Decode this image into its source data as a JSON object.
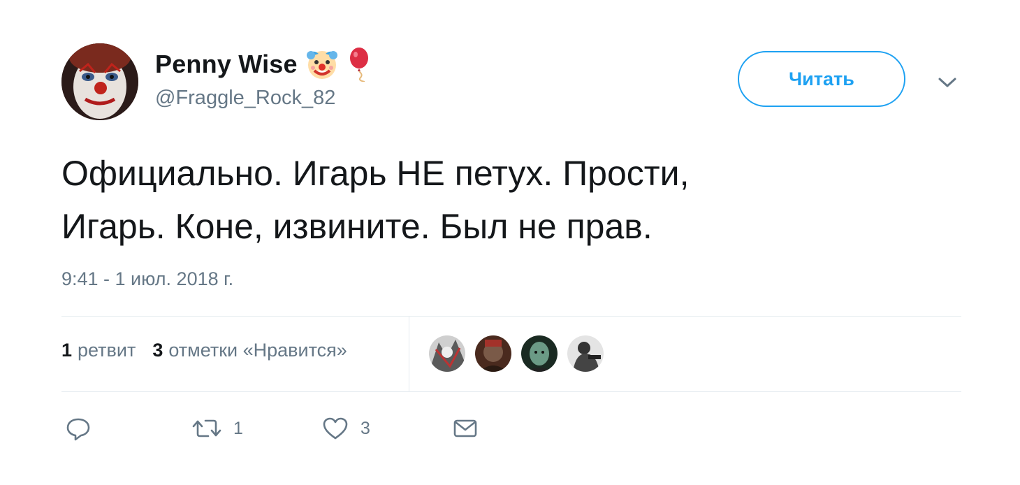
{
  "user": {
    "display_name": "Penny Wise",
    "username": "@Fraggle_Rock_82",
    "avatar_icon": "clown-avatar",
    "name_emoji": [
      "clown-face-icon",
      "balloon-icon"
    ]
  },
  "follow_button": {
    "label": "Читать"
  },
  "caret_icon": "chevron-down-icon",
  "tweet": {
    "text_line1": "Официально. Игарь НЕ петух. Прости,",
    "text_line2": "Игарь. Коне, извините. Был не прав.",
    "timestamp": "9:41 - 1 июл. 2018 г."
  },
  "stats": {
    "retweets_count": "1",
    "retweets_label": "ретвит",
    "likes_count": "3",
    "likes_label": "отметки «Нравится»"
  },
  "actions": {
    "reply_icon": "reply-icon",
    "retweet_icon": "retweet-icon",
    "retweet_count": "1",
    "like_icon": "heart-icon",
    "like_count": "3",
    "dm_icon": "envelope-icon"
  },
  "colors": {
    "accent": "#1da1f2",
    "text": "#14171a",
    "muted": "#657786",
    "divider": "#e6ecf0"
  }
}
